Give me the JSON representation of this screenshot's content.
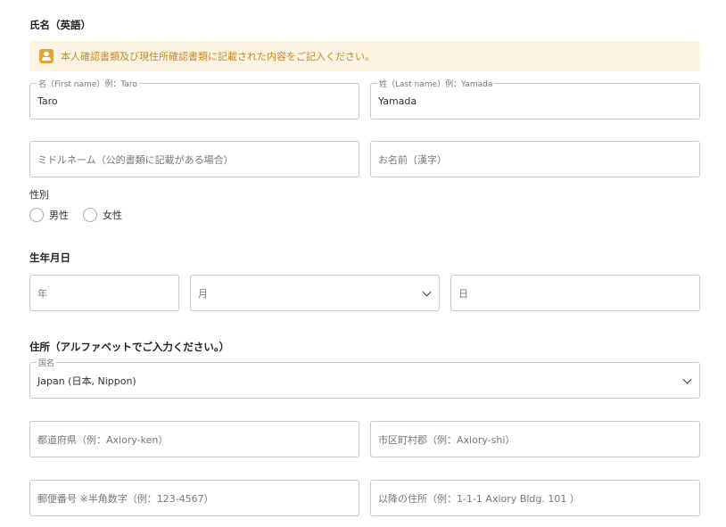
{
  "name_section": {
    "title": "氏名（英語）",
    "notice": "本人確認書類及び現住所確認書類に記載された内容をご記入ください。",
    "first_name": {
      "legend": "名（First name）例：Taro",
      "value": "Taro"
    },
    "last_name": {
      "legend": "姓（Last name）例：Yamada",
      "value": "Yamada"
    },
    "middle_name": {
      "placeholder": "ミドルネーム（公的書類に記載がある場合）"
    },
    "kanji_name": {
      "placeholder": "お名前（漢字）"
    }
  },
  "gender": {
    "label": "性別",
    "options": [
      "男性",
      "女性"
    ]
  },
  "birth_section": {
    "title": "生年月日",
    "year": {
      "placeholder": "年"
    },
    "month": {
      "placeholder": "月"
    },
    "day": {
      "placeholder": "日"
    }
  },
  "address_section": {
    "title": "住所（アルファベットでご入力ください。）",
    "country": {
      "legend": "国名",
      "value": "Japan (日本, Nippon)"
    },
    "prefecture": {
      "placeholder": "都道府県（例：Axiory-ken）"
    },
    "city": {
      "placeholder": "市区町村郡（例：Axiory-shi）"
    },
    "postal_code": {
      "placeholder": "郵便番号 ※半角数字（例：123-4567）"
    },
    "street": {
      "placeholder": "以降の住所（例：1-1-1 Axiory Bldg. 101 ）"
    }
  }
}
